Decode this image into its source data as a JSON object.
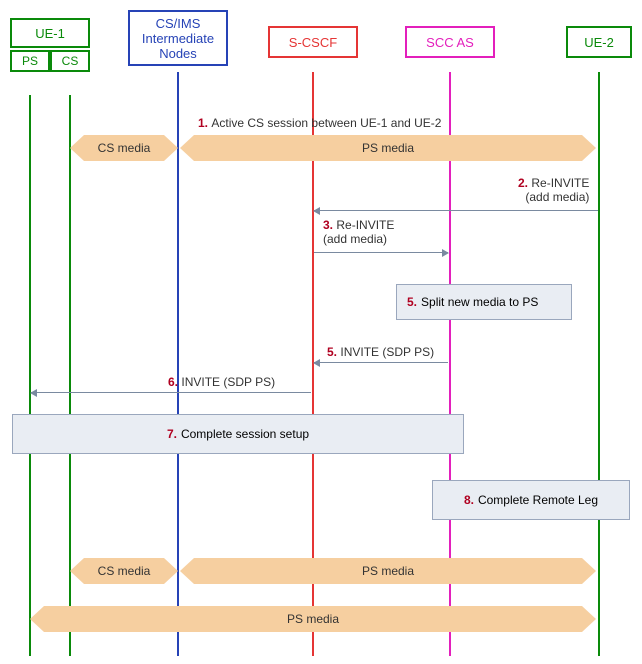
{
  "actors": {
    "ue1": {
      "label": "UE-1",
      "ps": "PS",
      "cs": "CS"
    },
    "intermediate": {
      "label": "CS/IMS Intermediate Nodes"
    },
    "scscf": {
      "label": "S-CSCF"
    },
    "sccas": {
      "label": "SCC AS"
    },
    "ue2": {
      "label": "UE-2"
    }
  },
  "steps": {
    "s1": {
      "num": "1.",
      "text": "Active CS session between UE-1 and UE-2"
    },
    "s2": {
      "num": "2.",
      "text": "Re-INVITE (add media)"
    },
    "s3": {
      "num": "3.",
      "text": "Re-INVITE (add media)"
    },
    "s5box": {
      "num": "5.",
      "text": "Split new media to PS"
    },
    "s5msg": {
      "num": "5.",
      "text": "INVITE (SDP PS)"
    },
    "s6": {
      "num": "6.",
      "text": "INVITE (SDP PS)"
    },
    "s7": {
      "num": "7.",
      "text": "Complete session setup"
    },
    "s8": {
      "num": "8.",
      "text": "Complete Remote Leg"
    }
  },
  "media": {
    "cs": "CS media",
    "ps": "PS media"
  },
  "colors": {
    "green": "#0a8a0a",
    "blue": "#2643b6",
    "red": "#e53535",
    "magenta": "#e31fbc",
    "band": "#f6cfa0",
    "arrow": "#7a8aa0",
    "box": "#e9edf3",
    "stepnum": "#b00020"
  },
  "chart_data": {
    "type": "sequence-diagram",
    "actors": [
      {
        "id": "ue1",
        "label": "UE-1",
        "sublanes": [
          "PS",
          "CS"
        ],
        "color": "green"
      },
      {
        "id": "intermediate",
        "label": "CS/IMS Intermediate Nodes",
        "color": "blue"
      },
      {
        "id": "scscf",
        "label": "S-CSCF",
        "color": "red"
      },
      {
        "id": "sccas",
        "label": "SCC AS",
        "color": "magenta"
      },
      {
        "id": "ue2",
        "label": "UE-2",
        "color": "green"
      }
    ],
    "events": [
      {
        "step": 1,
        "kind": "note",
        "text": "Active CS session between UE-1 and UE-2",
        "over": [
          "ue1",
          "ue2"
        ]
      },
      {
        "kind": "media",
        "label": "CS media",
        "between": [
          "ue1.cs",
          "intermediate"
        ],
        "direction": "both"
      },
      {
        "kind": "media",
        "label": "PS media",
        "between": [
          "intermediate",
          "ue2"
        ],
        "direction": "both"
      },
      {
        "step": 2,
        "kind": "message",
        "from": "ue2",
        "to": "scscf",
        "text": "Re-INVITE (add media)"
      },
      {
        "step": 3,
        "kind": "message",
        "from": "scscf",
        "to": "sccas",
        "text": "Re-INVITE (add media)"
      },
      {
        "step": 5,
        "kind": "action",
        "at": "sccas",
        "text": "Split new media to PS"
      },
      {
        "step": 5,
        "kind": "message",
        "from": "sccas",
        "to": "scscf",
        "text": "INVITE (SDP PS)"
      },
      {
        "step": 6,
        "kind": "message",
        "from": "scscf",
        "to": "ue1.ps",
        "text": "INVITE (SDP PS)"
      },
      {
        "step": 7,
        "kind": "action",
        "over": [
          "ue1",
          "sccas"
        ],
        "text": "Complete session setup"
      },
      {
        "step": 8,
        "kind": "action",
        "over": [
          "sccas",
          "ue2"
        ],
        "text": "Complete Remote Leg"
      },
      {
        "kind": "media",
        "label": "CS media",
        "between": [
          "ue1.cs",
          "intermediate"
        ],
        "direction": "both"
      },
      {
        "kind": "media",
        "label": "PS media",
        "between": [
          "intermediate",
          "ue2"
        ],
        "direction": "both"
      },
      {
        "kind": "media",
        "label": "PS media",
        "between": [
          "ue1.ps",
          "ue2"
        ],
        "direction": "both"
      }
    ]
  }
}
